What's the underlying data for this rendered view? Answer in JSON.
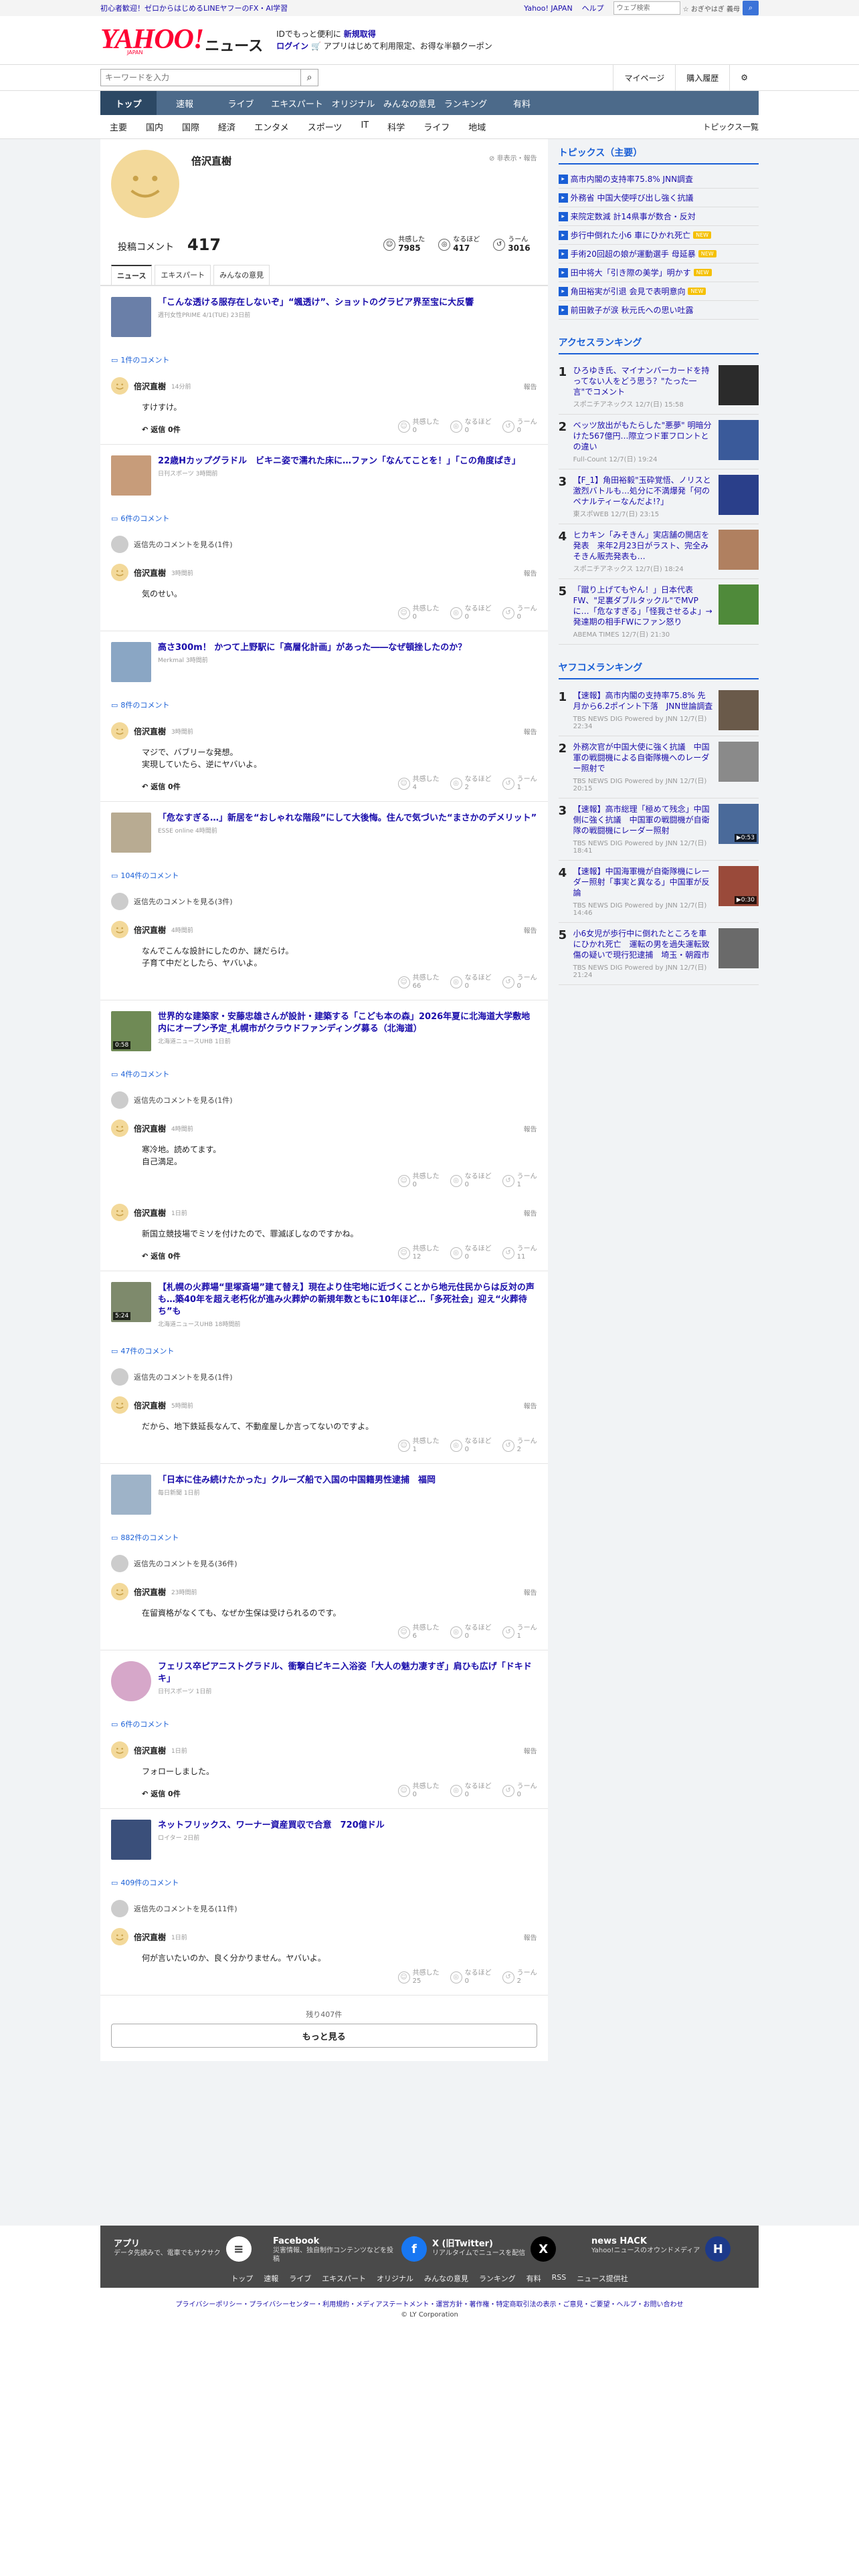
{
  "topbar": {
    "promo": "初心者歓迎！ゼロからはじめるLINEヤフーのFX・AI学習",
    "yahoo_japan": "Yahoo! JAPAN",
    "help": "ヘルプ",
    "search_placeholder": "ウェブ検索",
    "auction": "☆ おぎやはぎ 義母"
  },
  "header": {
    "logo": "YAHOO!",
    "logo_sub": "JAPAN",
    "news": "ニュース",
    "promo_line1": "IDでもっと便利に",
    "promo_new": "新規取得",
    "promo_login": "ログイン",
    "promo_line2": "アプリはじめて利用限定、お得な半額クーポン"
  },
  "search": {
    "placeholder": "キーワードを入力",
    "mypage": "マイページ",
    "history": "購入履歴"
  },
  "nav": [
    "トップ",
    "速報",
    "ライブ",
    "エキスパート",
    "オリジナル",
    "みんなの意見",
    "ランキング",
    "有料"
  ],
  "subnav": {
    "cats": [
      "主要",
      "国内",
      "国際",
      "経済",
      "エンタメ",
      "スポーツ",
      "IT",
      "科学",
      "ライフ",
      "地域"
    ],
    "all": "トピックス一覧"
  },
  "profile": {
    "name": "倍沢直樹",
    "report": "非表示・報告",
    "posts_label": "投稿コメント",
    "posts": "417",
    "reactions": [
      {
        "label": "共感した",
        "count": "7985"
      },
      {
        "label": "なるほど",
        "count": "417"
      },
      {
        "label": "うーん",
        "count": "3016"
      }
    ],
    "tabs": [
      "ニュース",
      "エキスパート",
      "みんなの意見"
    ]
  },
  "labels": {
    "reply": "返信",
    "report": "報告",
    "empathy": "共感した",
    "naruhodo": "なるほど",
    "uun": "うーん"
  },
  "articles": [
    {
      "title": "「こんな透ける服存在しないぞ」“颯透け”、ショットのグラビア界至宝に大反響",
      "source": "週刊女性PRIME 4/1(TUE)  23日前",
      "count": "1件のコメント",
      "more": "",
      "thumb": "#6a7fa8",
      "comments": [
        {
          "name": "倍沢直樹",
          "time": "14分前",
          "text": "すけすけ。",
          "reply": "返信 0件",
          "r": [
            "0",
            "0",
            "0"
          ]
        }
      ]
    },
    {
      "title": "22歳Hカップグラドル　ビキニ姿で濡れた床に…ファン「なんてことを！」「この角度ぱき」",
      "source": "日刊スポーツ 3時間前",
      "count": "6件のコメント",
      "more": "返信先のコメントを見る(1件)",
      "thumb": "#c79c7a",
      "comments": [
        {
          "name": "倍沢直樹",
          "time": "3時間前",
          "text": "気のせい。",
          "reply": "",
          "r": [
            "0",
            "0",
            "0"
          ]
        }
      ]
    },
    {
      "title": "高さ300m！ かつて上野駅に「高層化計画」があった――なぜ頓挫したのか？",
      "source": "Merkmal 3時間前",
      "count": "8件のコメント",
      "more": "",
      "thumb": "#8aa6c4",
      "comments": [
        {
          "name": "倍沢直樹",
          "time": "3時間前",
          "text": "マジで、バブリーな発想。\n実現していたら、逆にヤバいよ。",
          "reply": "返信 0件",
          "r": [
            "4",
            "2",
            "1"
          ]
        }
      ]
    },
    {
      "title": "「危なすぎる…」新居を“おしゃれな階段”にして大後悔。住んで気づいた“まさかのデメリット”",
      "source": "ESSE online 4時間前",
      "count": "104件のコメント",
      "more": "返信先のコメントを見る(3件)",
      "thumb": "#b8ab92",
      "comments": [
        {
          "name": "倍沢直樹",
          "time": "4時間前",
          "text": "なんでこんな設計にしたのか、謎だらけ。\n子育て中だとしたら、ヤバいよ。",
          "reply": "",
          "r": [
            "66",
            "0",
            "0"
          ]
        }
      ]
    },
    {
      "title": "世界的な建築家・安藤忠雄さんが設計・建築する「こども本の森」2026年夏に北海道大学敷地内にオープン予定_札幌市がクラウドファンディング募る（北海道）",
      "source": "北海道ニュースUHB 1日前",
      "count": "4件のコメント",
      "more": "返信先のコメントを見る(1件)",
      "thumb": "#6f8a55",
      "vid": "0:58",
      "comments": [
        {
          "name": "倍沢直樹",
          "time": "4時間前",
          "text": "寒冷地。読めてます。\n自己満足。",
          "reply": "",
          "r": [
            "0",
            "0",
            "1"
          ]
        },
        {
          "name": "倍沢直樹",
          "time": "1日前",
          "text": "新国立競技場でミソを付けたので、罪滅ぼしなのですかね。",
          "reply": "返信 0件",
          "r": [
            "12",
            "0",
            "11"
          ]
        }
      ]
    },
    {
      "title": "【札幌の火葬場“里塚斎場”建て替え】現在より住宅地に近づくことから地元住民からは反対の声も…築40年を超え老朽化が進み火葬炉の新規年数ともに10年ほど…「多死社会」迎え“火葬待ち”も",
      "source": "北海道ニュースUHB 18時間前",
      "count": "47件のコメント",
      "more": "返信先のコメントを見る(1件)",
      "thumb": "#7e8a6c",
      "vid": "5:24",
      "comments": [
        {
          "name": "倍沢直樹",
          "time": "5時間前",
          "text": "だから、地下鉄延長なんて、不動産屋しか言ってないのですよ。",
          "reply": "",
          "r": [
            "1",
            "0",
            "2"
          ]
        }
      ]
    },
    {
      "title": "「日本に住み続けたかった」クルーズ船で入国の中国籍男性逮捕　福岡",
      "source": "毎日新聞 1日前",
      "count": "882件のコメント",
      "more": "返信先のコメントを見る(36件)",
      "thumb": "#9eb3c8",
      "comments": [
        {
          "name": "倍沢直樹",
          "time": "23時間前",
          "text": "在留資格がなくても、なぜか生保は受けられるのです。",
          "reply": "",
          "r": [
            "6",
            "0",
            "1"
          ]
        }
      ]
    },
    {
      "title": "フェリス卒ピアニストグラドル、衝撃白ビキニ入浴姿「大人の魅力凄すぎ」肩ひも広げ「ドキドキ」",
      "source": "日刊スポーツ 1日前",
      "count": "6件のコメント",
      "more": "",
      "thumb": "#d6a7c9",
      "round": true,
      "comments": [
        {
          "name": "倍沢直樹",
          "time": "1日前",
          "text": "フォローしました。",
          "reply": "返信 0件",
          "r": [
            "0",
            "0",
            "0"
          ]
        }
      ]
    },
    {
      "title": "ネットフリックス、ワーナー資産買収で合意　720億ドル",
      "source": "ロイター 2日前",
      "count": "409件のコメント",
      "more": "返信先のコメントを見る(11件)",
      "thumb": "#3a4f7a",
      "comments": [
        {
          "name": "倍沢直樹",
          "time": "1日前",
          "text": "何が言いたいのか、良く分かりません。ヤバいよ。",
          "reply": "",
          "r": [
            "25",
            "0",
            "2"
          ]
        }
      ]
    }
  ],
  "more": {
    "remaining": "残り407件",
    "button": "もっと見る"
  },
  "topics": {
    "title": "トピックス（主要）",
    "items": [
      {
        "t": "高市内閣の支持率75.8% JNN調査",
        "b": ""
      },
      {
        "t": "外務省 中国大使呼び出し強く抗議",
        "b": ""
      },
      {
        "t": "来院定数減 計14県事が数合・反対",
        "b": ""
      },
      {
        "t": "歩行中倒れた小6 車にひかれ死亡",
        "b": "NEW"
      },
      {
        "t": "手術20回超の娘が運動選手 母延暴",
        "b": "NEW"
      },
      {
        "t": "田中将大「引き際の美学」明かす",
        "b": "NEW"
      },
      {
        "t": "角田裕実が引退 会見で表明意向",
        "b": "NEW"
      },
      {
        "t": "前田敦子が涙 秋元氏への思い吐露",
        "b": ""
      }
    ]
  },
  "access": {
    "title": "アクセスランキング",
    "items": [
      {
        "n": "1",
        "t": "ひろゆき氏、マイナンバーカードを持ってない人をどう思う？\"たった一言\"でコメント",
        "s": "スポニチアネックス 12/7(日) 15:58",
        "c": "#2b2b2b"
      },
      {
        "n": "2",
        "t": "ベッツ放出がもたらした\"悪夢\" 明暗分けた567億円…際立つド軍フロントとの違い",
        "s": "Full-Count 12/7(日) 19:24",
        "c": "#3a5a9a"
      },
      {
        "n": "3",
        "t": "【F_1】角田裕毅\"玉砕覚悟、ノリスと激烈バトルも…処分に不満爆発「何のペナルティーなんだよ!?」",
        "s": "東スポWEB 12/7(日) 23:15",
        "c": "#2a3f8a"
      },
      {
        "n": "4",
        "t": "ヒカキン「みそきん」実店舗の開店を発表　来年2月23日がラスト、完全みそきん販売発表も…",
        "s": "スポニチアネックス 12/7(日) 18:24",
        "c": "#b08060"
      },
      {
        "n": "5",
        "t": "「蹴り上げてもやん！」日本代表FW、\"足裏ダブルタックル\"でMVPに…「危なすぎる」「怪我させるよ」→発達期の相手FWにファン怒り",
        "s": "ABEMA TIMES 12/7(日) 21:30",
        "c": "#4f8a3a"
      }
    ]
  },
  "yafuko": {
    "title": "ヤフコメランキング",
    "items": [
      {
        "n": "1",
        "t": "【速報】高市内閣の支持率75.8% 先月から6.2ポイント下落　JNN世論調査",
        "s": "TBS NEWS DIG Powered by JNN 12/7(日) 22:34",
        "c": "#6a5a4a",
        "v": ""
      },
      {
        "n": "2",
        "t": "外務次官が中国大使に強く抗議　中国軍の戦闘機による自衛隊機へのレーダー照射で",
        "s": "TBS NEWS DIG Powered by JNN 12/7(日) 20:15",
        "c": "#8a8a8a",
        "v": ""
      },
      {
        "n": "3",
        "t": "【速報】高市総理「極めて残念」中国側に強く抗議　中国軍の戦闘機が自衛隊の戦闘機にレーダー照射",
        "s": "TBS NEWS DIG Powered by JNN 12/7(日) 18:41",
        "c": "#4a6a9a",
        "v": "0:53"
      },
      {
        "n": "4",
        "t": "【速報】中国海軍機が自衛隊機にレーダー照射「事実と異なる」中国軍が反論",
        "s": "TBS NEWS DIG Powered by JNN 12/7(日) 14:46",
        "c": "#9a4a3a",
        "v": "0:30"
      },
      {
        "n": "5",
        "t": "小6女児が歩行中に倒れたところを車にひかれ死亡　運転の男を過失運転致傷の疑いで現行犯逮捕　埼玉・朝霞市",
        "s": "TBS NEWS DIG Powered by JNN 12/7(日) 21:24",
        "c": "#6a6a6a",
        "v": ""
      }
    ]
  },
  "footer": {
    "apps": [
      {
        "t": "アプリ",
        "d": "データ先読みで、電車でもサクサク",
        "ic": "≡",
        "bg": "#fff",
        "fg": "#333"
      },
      {
        "t": "Facebook",
        "d": "災害情報、独自制作コンテンツなどを投稿",
        "ic": "f",
        "bg": "#1877f2",
        "fg": "#fff"
      },
      {
        "t": "X (旧Twitter)",
        "d": "リアルタイムでニュースを配信",
        "ic": "X",
        "bg": "#000",
        "fg": "#fff"
      },
      {
        "t": "news HACK",
        "d": "Yahoo!ニュースのオウンドメディア",
        "ic": "H",
        "bg": "#1d3a8a",
        "fg": "#fff"
      }
    ],
    "links": [
      "トップ",
      "速報",
      "ライブ",
      "エキスパート",
      "オリジナル",
      "みんなの意見",
      "ランキング",
      "有料",
      "RSS",
      "ニュース提供社"
    ]
  },
  "legal": "プライバシーポリシー・プライバシーセンター・利用規約・メディアステートメント・運営方針・著作権・特定商取引法の表示・ご意見・ご要望・ヘルプ・お問い合わせ",
  "copyright": "© LY Corporation"
}
